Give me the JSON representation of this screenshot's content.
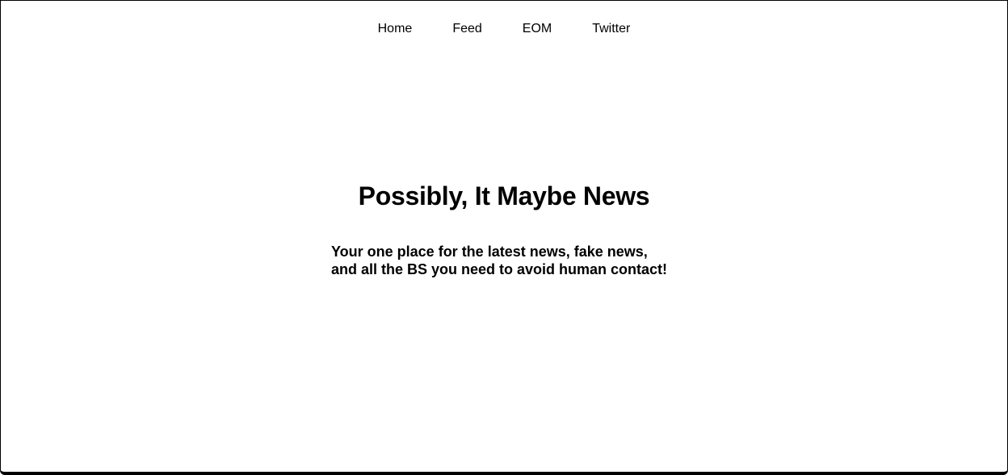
{
  "nav": {
    "items": [
      {
        "label": "Home"
      },
      {
        "label": "Feed"
      },
      {
        "label": "EOM"
      },
      {
        "label": "Twitter"
      }
    ]
  },
  "hero": {
    "title": "Possibly, It Maybe News",
    "tagline_line1": "Your one place for the latest news, fake news,",
    "tagline_line2": "and all the BS you need to avoid human contact!"
  },
  "colors": {
    "background": "#ffffff",
    "text": "#000000",
    "frame_border": "#000000"
  }
}
